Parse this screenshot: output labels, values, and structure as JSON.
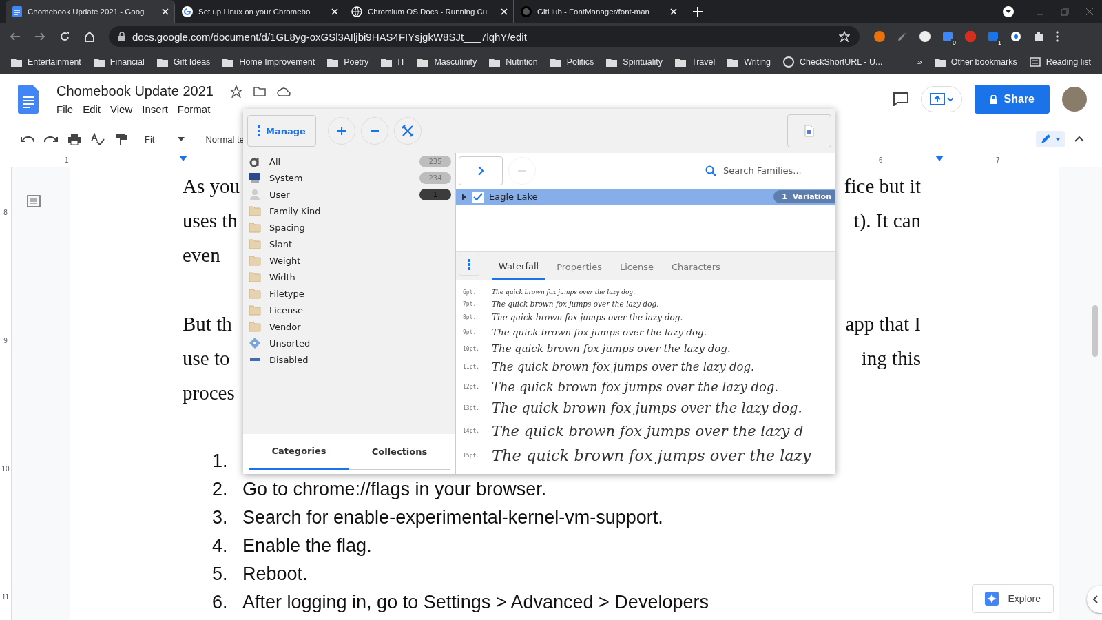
{
  "browser": {
    "tabs": [
      {
        "title": "Chomebook Update 2021 - Goog",
        "kind": "docs",
        "selected": true
      },
      {
        "title": "Set up Linux on your Chromebo",
        "kind": "google",
        "selected": false
      },
      {
        "title": "Chromium OS Docs - Running Cu",
        "kind": "globe",
        "selected": false
      },
      {
        "title": "GitHub - FontManager/font-man",
        "kind": "github",
        "selected": false
      }
    ],
    "url": "docs.google.com/document/d/1GL8yg-oxGSl3AIljbi9HAS4FIYsjgkW8SJt___7lqhY/edit",
    "extension_badges": [
      "0",
      "1"
    ],
    "bookmarks": [
      {
        "label": "Entertainment",
        "kind": "folder"
      },
      {
        "label": "Financial",
        "kind": "folder"
      },
      {
        "label": "Gift Ideas",
        "kind": "folder"
      },
      {
        "label": "Home Improvement",
        "kind": "folder"
      },
      {
        "label": "Poetry",
        "kind": "folder"
      },
      {
        "label": "IT",
        "kind": "folder"
      },
      {
        "label": "Masculinity",
        "kind": "folder"
      },
      {
        "label": "Nutrition",
        "kind": "folder"
      },
      {
        "label": "Politics",
        "kind": "folder"
      },
      {
        "label": "Spirituality",
        "kind": "folder"
      },
      {
        "label": "Travel",
        "kind": "folder"
      },
      {
        "label": "Writing",
        "kind": "folder"
      },
      {
        "label": "CheckShortURL - U...",
        "kind": "site"
      }
    ],
    "overflow": "»",
    "other_bookmarks": "Other bookmarks",
    "reading_list": "Reading list"
  },
  "docs": {
    "title": "Chomebook Update 2021",
    "menu": [
      "File",
      "Edit",
      "View",
      "Insert",
      "Format"
    ],
    "zoom": "Fit",
    "style": "Normal te",
    "share": "Share",
    "ruler_numbers": [
      "1",
      "6",
      "7"
    ],
    "side_ruler": [
      "8",
      "9",
      "10",
      "11"
    ],
    "paragraphs": [
      {
        "lines": [
          {
            "left": "As you",
            "right": "fice but it"
          },
          {
            "left": "uses th",
            "right": "t). It can"
          },
          {
            "left": "even"
          }
        ]
      },
      {
        "lines": [
          {
            "left": "But th",
            "right": "app that I"
          },
          {
            "left": "use to",
            "right": "ing this"
          },
          {
            "left": "proces"
          }
        ]
      }
    ],
    "list": [
      {
        "number": "1."
      },
      {
        "number": "2.",
        "text": "Go to chrome://flags in your browser."
      },
      {
        "number": "3.",
        "text": "Search for enable-experimental-kernel-vm-support."
      },
      {
        "number": "4.",
        "text": "Enable the flag."
      },
      {
        "number": "5.",
        "text": "Reboot."
      },
      {
        "number": "6.",
        "text": "After logging in, go to Settings > Advanced > Developers"
      }
    ],
    "explore": "Explore"
  },
  "font_manager": {
    "manage": "Manage",
    "categories": [
      {
        "label": "All",
        "kind": "font",
        "count": "235",
        "color": "#bdbdbd"
      },
      {
        "label": "System",
        "kind": "computer",
        "count": "234",
        "color": "#bdbdbd"
      },
      {
        "label": "User",
        "kind": "user",
        "count": "1",
        "color": "#3c3c3c"
      },
      {
        "label": "Family Kind",
        "kind": "folder"
      },
      {
        "label": "Spacing",
        "kind": "folder"
      },
      {
        "label": "Slant",
        "kind": "folder"
      },
      {
        "label": "Weight",
        "kind": "folder"
      },
      {
        "label": "Width",
        "kind": "folder"
      },
      {
        "label": "Filetype",
        "kind": "folder"
      },
      {
        "label": "License",
        "kind": "folder"
      },
      {
        "label": "Vendor",
        "kind": "folder"
      },
      {
        "label": "Unsorted",
        "kind": "unsorted"
      },
      {
        "label": "Disabled",
        "kind": "disabled"
      }
    ],
    "side_tabs": [
      {
        "label": "Categories",
        "selected": true
      },
      {
        "label": "Collections",
        "selected": false
      }
    ],
    "search": {
      "placeholder": "Search Families..."
    },
    "families": [
      {
        "name": "Eagle Lake",
        "checked": true,
        "selected": true,
        "variations": "1  Variation"
      }
    ],
    "tabs": [
      {
        "label": "Waterfall",
        "selected": true
      },
      {
        "label": "Properties",
        "selected": false
      },
      {
        "label": "License",
        "selected": false
      },
      {
        "label": "Characters",
        "selected": false
      }
    ],
    "waterfall": [
      {
        "size": "6pt.",
        "sample": "The quick brown fox jumps over the lazy dog."
      },
      {
        "size": "7pt.",
        "sample": "The quick brown fox jumps over the lazy dog."
      },
      {
        "size": "8pt.",
        "sample": "The quick brown fox jumps over the lazy dog."
      },
      {
        "size": "9pt.",
        "sample": "The quick brown fox jumps over the lazy dog."
      },
      {
        "size": "10pt.",
        "sample": "The quick brown fox jumps over the lazy dog."
      },
      {
        "size": "11pt.",
        "sample": "The quick brown fox jumps over the lazy dog."
      },
      {
        "size": "12pt.",
        "sample": "The quick brown fox jumps over the lazy dog."
      },
      {
        "size": "13pt.",
        "sample": "The quick brown fox jumps over the lazy dog."
      },
      {
        "size": "14pt.",
        "sample": "The quick brown fox jumps over the lazy d"
      },
      {
        "size": "15pt.",
        "sample": "The quick brown fox jumps over the lazy"
      }
    ]
  }
}
